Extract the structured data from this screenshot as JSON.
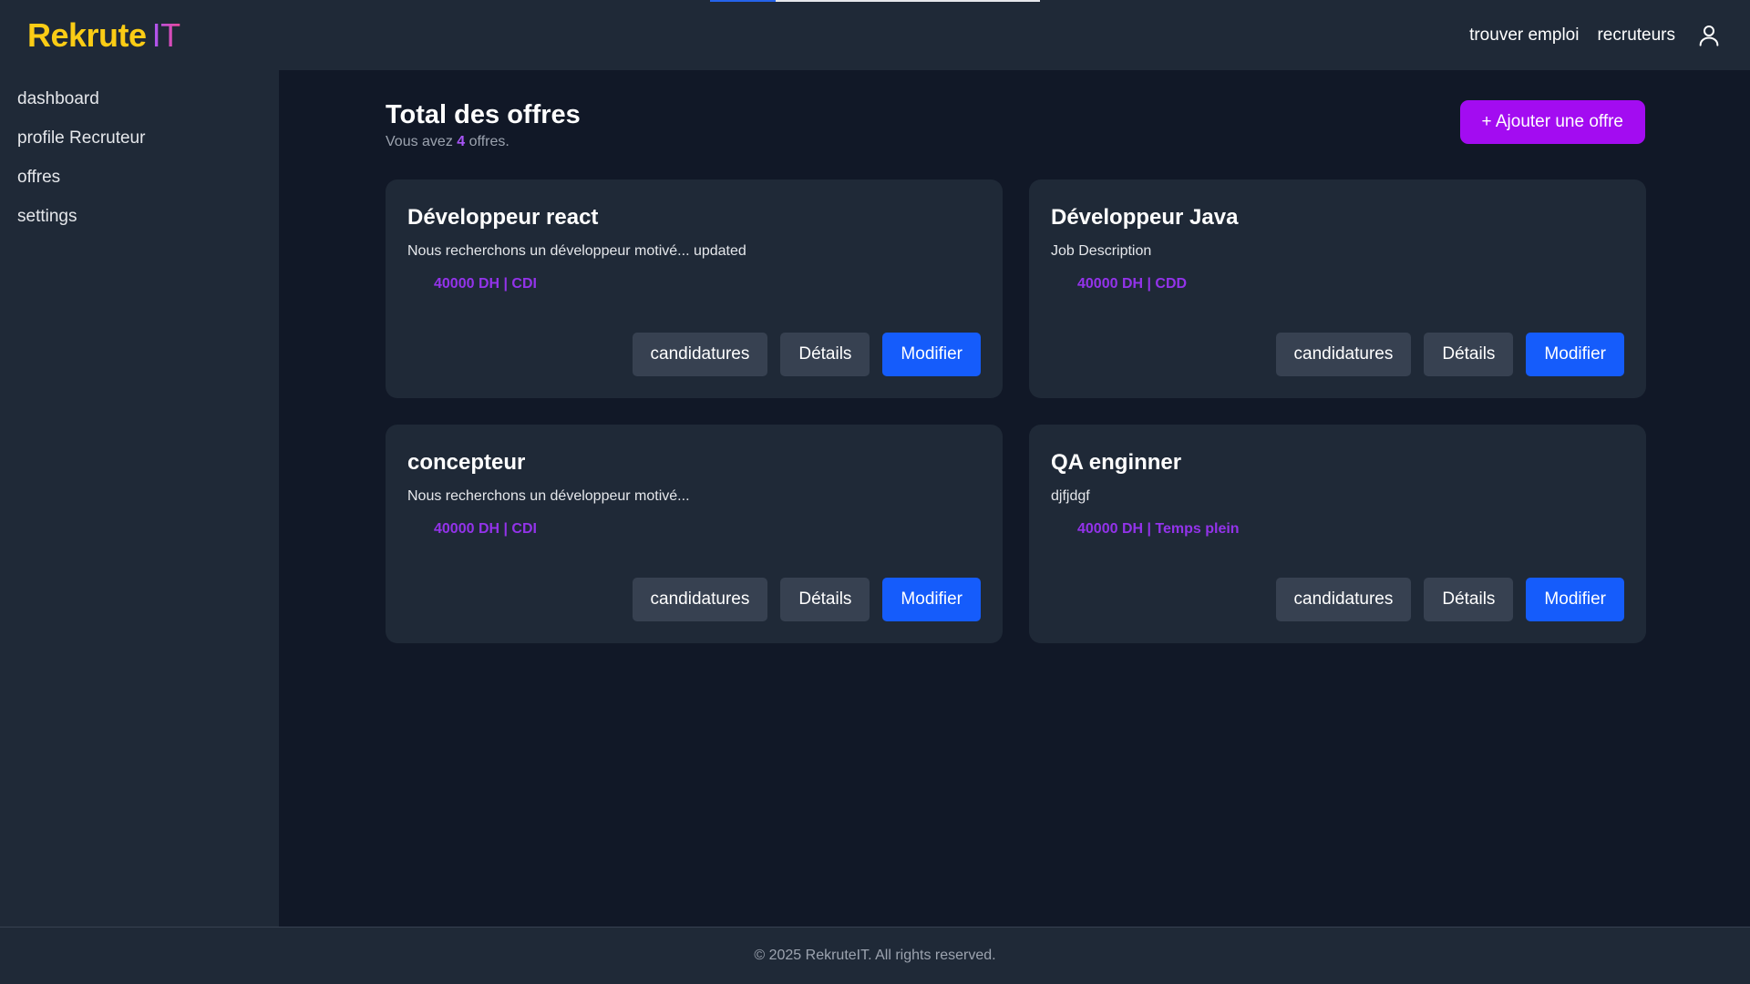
{
  "progress": {
    "fraction": 0.2,
    "colors": {
      "fill": "#2563eb",
      "track": "#e5e7eb"
    }
  },
  "brand": {
    "name_main": "Rekrute",
    "name_accent": "IT"
  },
  "header": {
    "links": [
      {
        "label": "trouver emploi"
      },
      {
        "label": "recruteurs"
      }
    ],
    "user_icon": "user-icon"
  },
  "sidebar": {
    "items": [
      {
        "label": "dashboard"
      },
      {
        "label": "profile Recruteur"
      },
      {
        "label": "offres"
      },
      {
        "label": "settings"
      }
    ]
  },
  "main": {
    "title": "Total des offres",
    "subtitle_prefix": "Vous avez ",
    "count": "4",
    "subtitle_suffix": " offres.",
    "add_button": "+ Ajouter une offre",
    "offers": [
      {
        "title": "Développeur react",
        "description": "Nous recherchons un développeur motivé... updated",
        "meta": "40000 DH | CDI",
        "actions": {
          "applications": "candidatures",
          "details": "Détails",
          "edit": "Modifier"
        }
      },
      {
        "title": "Développeur Java",
        "description": "Job Description",
        "meta": "40000 DH | CDD",
        "actions": {
          "applications": "candidatures",
          "details": "Détails",
          "edit": "Modifier"
        }
      },
      {
        "title": "concepteur",
        "description": "Nous recherchons un développeur motivé...",
        "meta": "40000 DH | CDI",
        "actions": {
          "applications": "candidatures",
          "details": "Détails",
          "edit": "Modifier"
        }
      },
      {
        "title": "QA enginner",
        "description": "djfjdgf",
        "meta": "40000 DH | Temps plein",
        "actions": {
          "applications": "candidatures",
          "details": "Détails",
          "edit": "Modifier"
        }
      }
    ]
  },
  "footer": {
    "text": "© 2025 RekruteIT. All rights reserved."
  },
  "colors": {
    "page_bg": "#111827",
    "panel_bg": "#1f2937",
    "brand_yellow": "#facc15",
    "brand_purple": "#a855f7",
    "accent_purple": "#a30cf1",
    "primary_blue": "#155cfb",
    "secondary_gray": "#374151"
  }
}
